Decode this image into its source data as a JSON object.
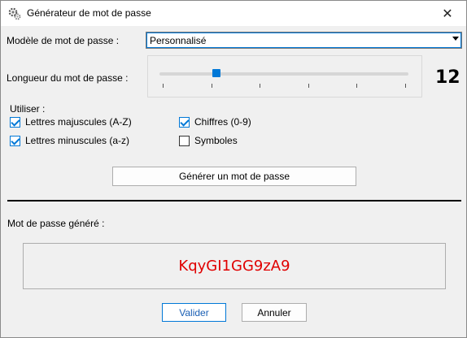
{
  "window": {
    "title": "Générateur de mot de passe",
    "close_glyph": "✕"
  },
  "template": {
    "label": "Modèle de mot de passe :",
    "selected": "Personnalisé"
  },
  "length": {
    "label": "Longueur du mot de passe :",
    "value": "12",
    "slider_fraction": 0.23,
    "tick_count": 6
  },
  "options": {
    "label": "Utiliser :",
    "uppercase": {
      "label": "Lettres majuscules (A-Z)",
      "checked": true
    },
    "lowercase": {
      "label": "Lettres minuscules (a-z)",
      "checked": true
    },
    "digits": {
      "label": "Chiffres (0-9)",
      "checked": true
    },
    "symbols": {
      "label": "Symboles",
      "checked": false
    }
  },
  "generate_button": "Générer un mot de passe",
  "result": {
    "label": "Mot de passe généré :",
    "password": "KqyGI1GG9zA9"
  },
  "footer": {
    "ok": "Valider",
    "cancel": "Annuler"
  },
  "colors": {
    "accent": "#0078d7",
    "password": "#e00000"
  }
}
